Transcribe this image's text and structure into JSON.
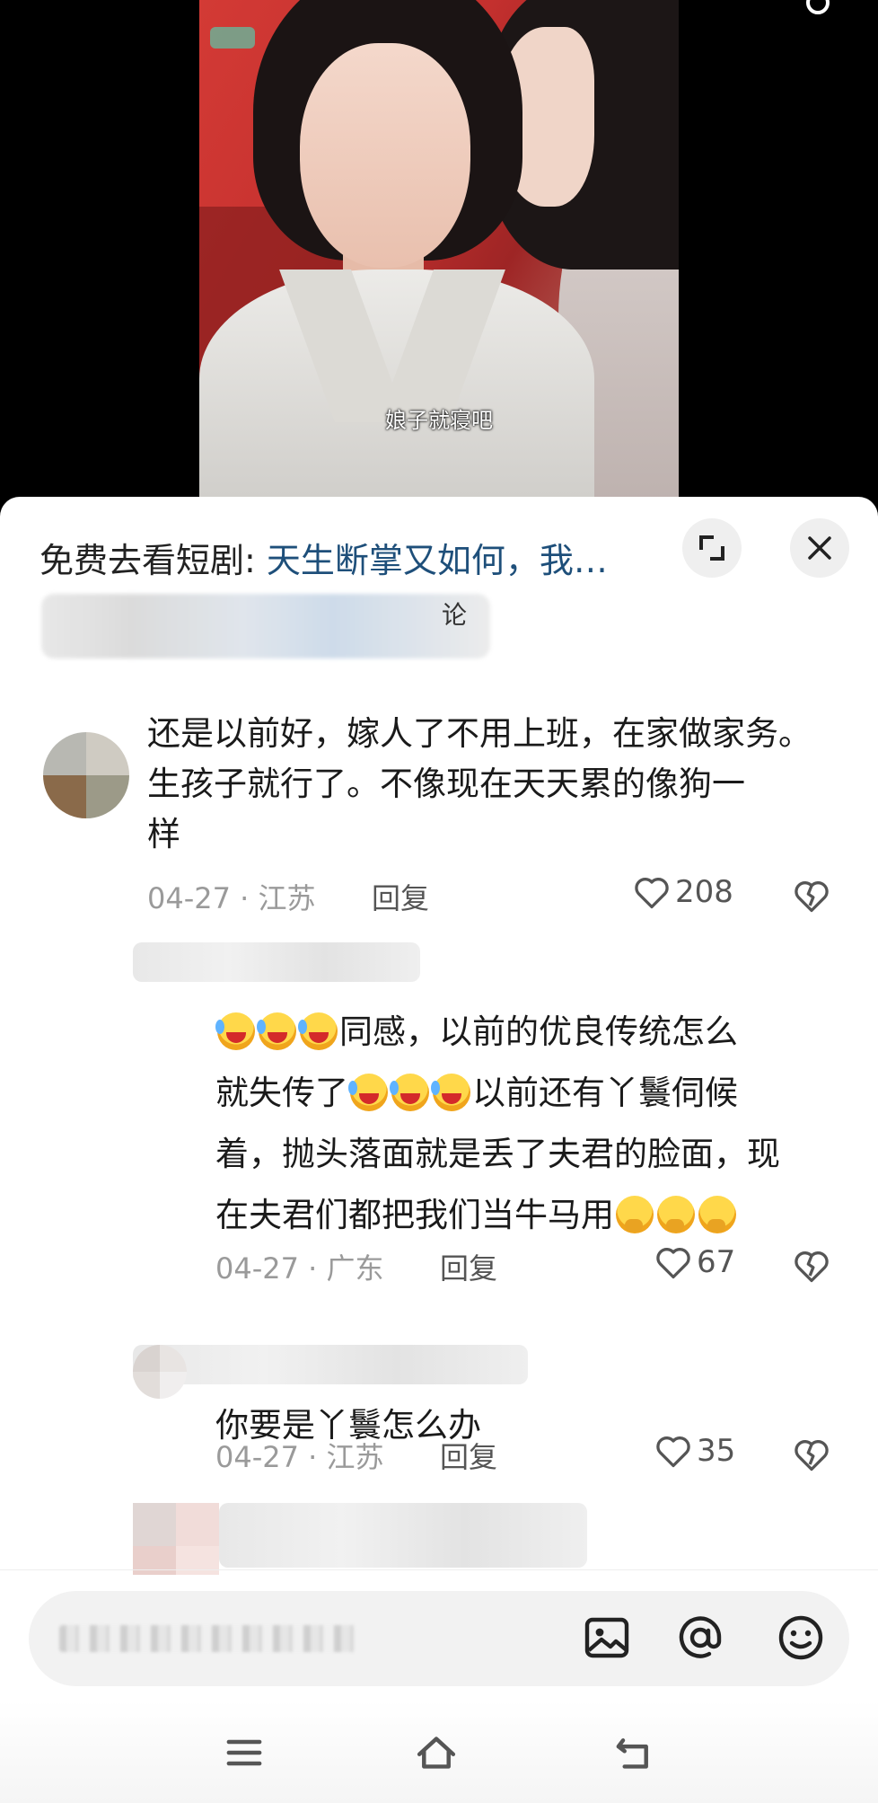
{
  "video": {
    "subtitle": "娘子就寝吧"
  },
  "sheet": {
    "drama_prefix": "免费去看短剧: ",
    "drama_title": "天生断掌又如何，我…",
    "comment_count_suffix": "论"
  },
  "comments": [
    {
      "text_line1": "还是以前好，嫁人了不用上班，在家做家务。",
      "text_line2": "生孩子就行了。不像现在天天累的像狗一",
      "text_line3": "样",
      "date_location": "04-27 · 江苏",
      "reply_label": "回复",
      "likes": "208"
    },
    {
      "text_line1": "同感，以前的优良传统怎么",
      "text_line2a": "就失传了",
      "text_line2b": "以前还有丫鬟伺候",
      "text_line3": "着，抛头落面就是丢了夫君的脸面，现",
      "text_line4": "在夫君们都把我们当牛马用",
      "date_location": "04-27 · 广东",
      "reply_label": "回复",
      "likes": "67"
    },
    {
      "text_line1": "你要是丫鬟怎么办",
      "date_location": "04-27 · 江苏",
      "reply_label": "回复",
      "likes": "35"
    }
  ],
  "icons": {
    "close": "close-icon",
    "expand": "expand-icon",
    "heart": "heart-icon",
    "dislike": "broken-heart-icon",
    "image": "image-icon",
    "at": "at-icon",
    "emoji": "emoji-icon",
    "menu": "menu-icon",
    "home": "home-icon",
    "back": "back-icon"
  },
  "colors": {
    "link_title": "#1e4f7a",
    "meta_gray": "#9a9a9a",
    "sheet_bg": "#ffffff"
  }
}
